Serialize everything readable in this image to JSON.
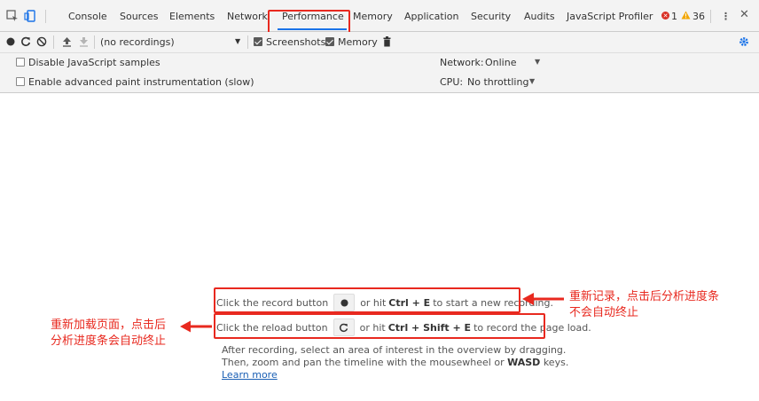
{
  "tabs": [
    {
      "label": "Console"
    },
    {
      "label": "Sources"
    },
    {
      "label": "Elements"
    },
    {
      "label": "Network"
    },
    {
      "label": "Performance"
    },
    {
      "label": "Memory"
    },
    {
      "label": "Application"
    },
    {
      "label": "Security"
    },
    {
      "label": "Audits"
    },
    {
      "label": "JavaScript Profiler"
    }
  ],
  "active_tab": "Performance",
  "status": {
    "errors": "1",
    "warnings": "36"
  },
  "toolbar": {
    "recordings_placeholder": "(no recordings)",
    "screenshots_label": "Screenshots",
    "memory_label": "Memory"
  },
  "options": {
    "disable_js_samples": "Disable JavaScript samples",
    "advanced_paint": "Enable advanced paint instrumentation (slow)",
    "network_label": "Network:",
    "network_value": "Online",
    "cpu_label": "CPU:",
    "cpu_value": "No throttling"
  },
  "landing": {
    "record_pre": "Click the record button",
    "record_mid": "or hit",
    "record_keys": "Ctrl + E",
    "record_post": "to start a new recording.",
    "reload_pre": "Click the reload button",
    "reload_mid": "or hit",
    "reload_keys": "Ctrl + Shift + E",
    "reload_post": "to record the page load.",
    "para_line1": "After recording, select an area of interest in the overview by dragging.",
    "para_line2_pre": "Then, zoom and pan the timeline with the mousewheel or",
    "para_line2_keys": "WASD",
    "para_line2_post": "keys.",
    "learn_more": "Learn more"
  },
  "annotations": {
    "right_line1": "重新记录，点击后分析进度条",
    "right_line2": "不会自动终止",
    "left_line1": "重新加载页面，点击后",
    "left_line2": "分析进度条会自动终止"
  },
  "colors": {
    "accent": "#1a73e8",
    "annotation": "#e8291f",
    "error": "#d93025",
    "warning": "#f2a600"
  }
}
